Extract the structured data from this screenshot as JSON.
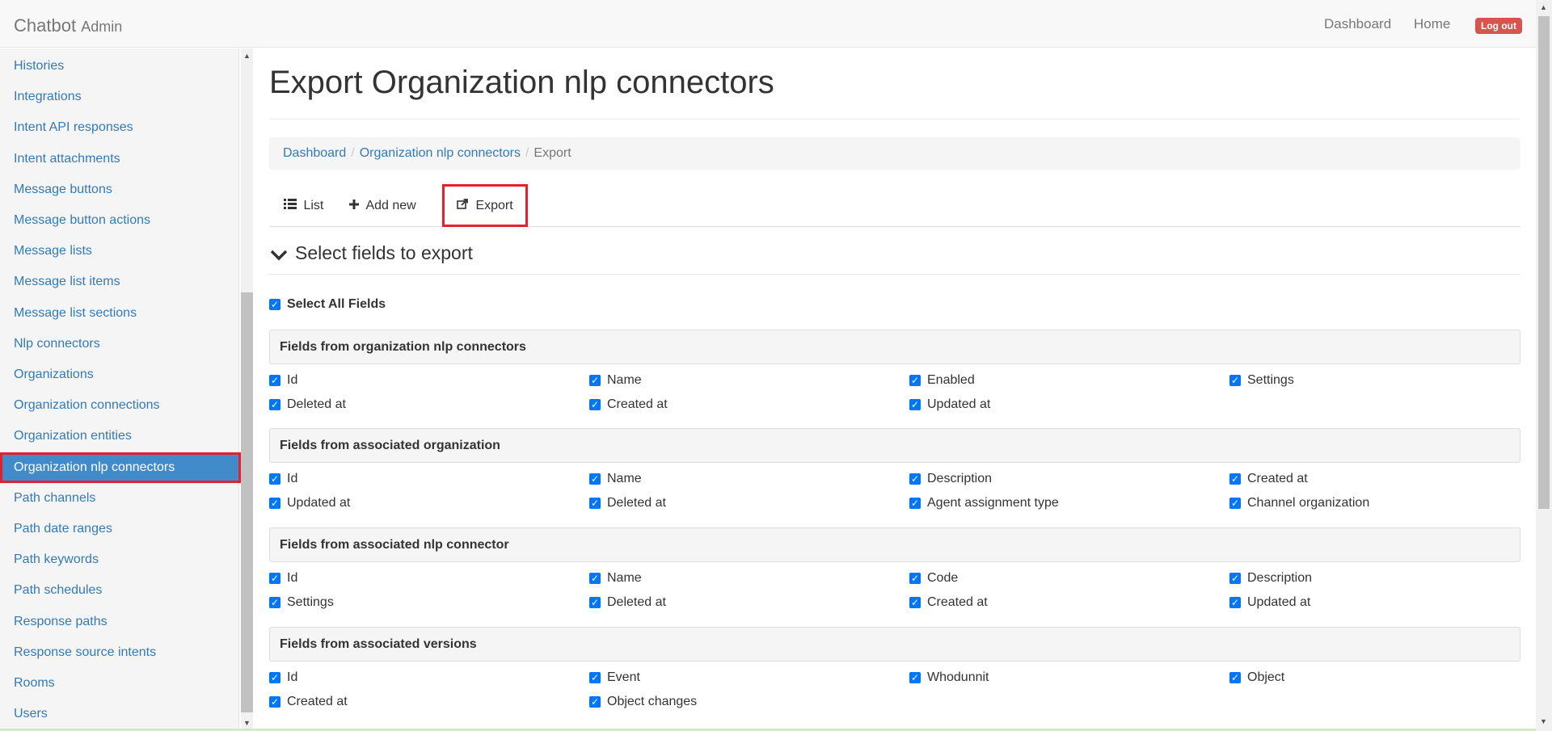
{
  "navbar": {
    "brand": "Chatbot",
    "brand_sub": "Admin",
    "links": [
      "Dashboard",
      "Home"
    ],
    "logout": "Log out"
  },
  "sidebar": {
    "items": [
      {
        "label": "Histories",
        "active": false
      },
      {
        "label": "Integrations",
        "active": false
      },
      {
        "label": "Intent API responses",
        "active": false
      },
      {
        "label": "Intent attachments",
        "active": false
      },
      {
        "label": "Message buttons",
        "active": false
      },
      {
        "label": "Message button actions",
        "active": false
      },
      {
        "label": "Message lists",
        "active": false
      },
      {
        "label": "Message list items",
        "active": false
      },
      {
        "label": "Message list sections",
        "active": false
      },
      {
        "label": "Nlp connectors",
        "active": false
      },
      {
        "label": "Organizations",
        "active": false
      },
      {
        "label": "Organization connections",
        "active": false
      },
      {
        "label": "Organization entities",
        "active": false
      },
      {
        "label": "Organization nlp connectors",
        "active": true
      },
      {
        "label": "Path channels",
        "active": false
      },
      {
        "label": "Path date ranges",
        "active": false
      },
      {
        "label": "Path keywords",
        "active": false
      },
      {
        "label": "Path schedules",
        "active": false
      },
      {
        "label": "Response paths",
        "active": false
      },
      {
        "label": "Response source intents",
        "active": false
      },
      {
        "label": "Rooms",
        "active": false
      },
      {
        "label": "Users",
        "active": false
      }
    ]
  },
  "page": {
    "title": "Export Organization nlp connectors",
    "breadcrumb": {
      "items": [
        "Dashboard",
        "Organization nlp connectors"
      ],
      "current": "Export"
    },
    "tabs": {
      "list": "List",
      "add_new": "Add new",
      "export": "Export"
    },
    "section_title": "Select fields to export",
    "select_all": {
      "label": "Select All Fields",
      "checked": true
    },
    "groups": [
      {
        "title": "Fields from organization nlp connectors",
        "fields": [
          "Id",
          "Name",
          "Enabled",
          "Settings",
          "Deleted at",
          "Created at",
          "Updated at"
        ]
      },
      {
        "title": "Fields from associated organization",
        "fields": [
          "Id",
          "Name",
          "Description",
          "Created at",
          "Updated at",
          "Deleted at",
          "Agent assignment type",
          "Channel organization"
        ]
      },
      {
        "title": "Fields from associated nlp connector",
        "fields": [
          "Id",
          "Name",
          "Code",
          "Description",
          "Settings",
          "Deleted at",
          "Created at",
          "Updated at"
        ]
      },
      {
        "title": "Fields from associated versions",
        "fields": [
          "Id",
          "Event",
          "Whodunnit",
          "Object",
          "Created at",
          "Object changes"
        ]
      }
    ]
  },
  "colors": {
    "link": "#337ab7",
    "active_bg": "#428bca",
    "highlight_border": "#e4202e",
    "checkbox": "#0075ff",
    "logout": "#d9534f"
  },
  "icons": {
    "list_tab": "list-icon",
    "add_tab": "plus-icon",
    "export_tab": "share-icon",
    "section": "chevron-down-icon",
    "checkbox": "checkmark-icon"
  }
}
